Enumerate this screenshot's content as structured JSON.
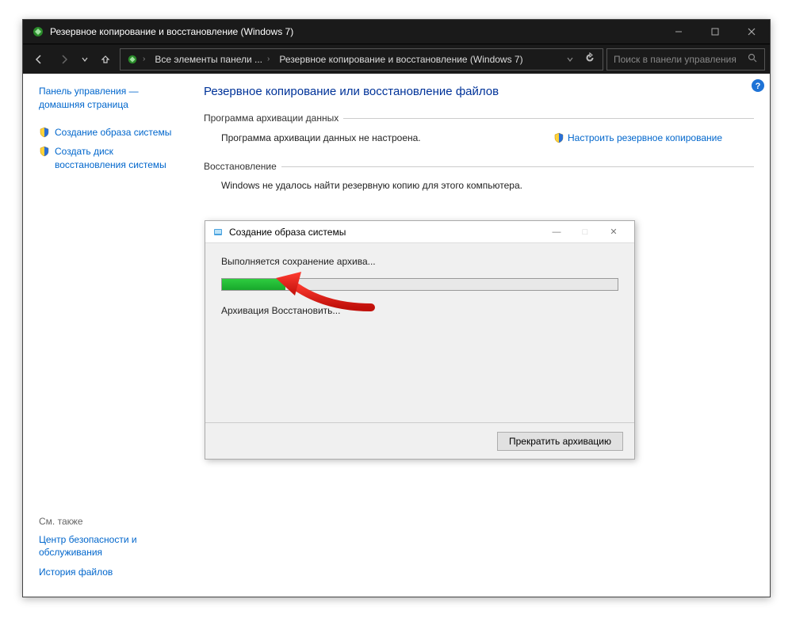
{
  "window": {
    "title": "Резервное копирование и восстановление (Windows 7)"
  },
  "nav": {
    "crumb1": "Все элементы панели ...",
    "crumb2": "Резервное копирование и восстановление (Windows 7)",
    "search_placeholder": "Поиск в панели управления"
  },
  "sidebar": {
    "home": "Панель управления — домашняя страница",
    "link1": "Создание образа системы",
    "link2": "Создать диск восстановления системы",
    "see_also": "См. также",
    "foot1": "Центр безопасности и обслуживания",
    "foot2": "История файлов"
  },
  "main": {
    "heading": "Резервное копирование или восстановление файлов",
    "group1": "Программа архивации данных",
    "group1_text": "Программа архивации данных не настроена.",
    "configure": "Настроить резервное копирование",
    "group2": "Восстановление",
    "group2_text": "Windows не удалось найти резервную копию для этого компьютера."
  },
  "dialog": {
    "title": "Создание образа системы",
    "msg": "Выполняется сохранение архива...",
    "status": "Архивация Восстановить...",
    "cancel": "Прекратить архивацию"
  }
}
